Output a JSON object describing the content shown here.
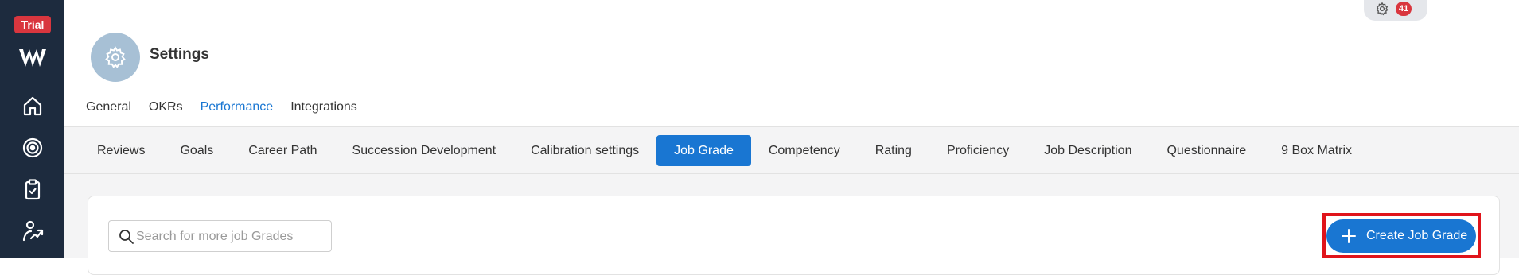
{
  "sidebar": {
    "trial_label": "Trial",
    "items": [
      {
        "icon": "home-icon"
      },
      {
        "icon": "target-icon"
      },
      {
        "icon": "clipboard-check-icon"
      },
      {
        "icon": "person-growth-icon"
      }
    ]
  },
  "topbar": {
    "notification_count": "41",
    "icon": "gear-icon"
  },
  "header": {
    "title": "Settings",
    "icon": "gear-icon"
  },
  "primary_tabs": [
    {
      "label": "General",
      "active": false
    },
    {
      "label": "OKRs",
      "active": false
    },
    {
      "label": "Performance",
      "active": true
    },
    {
      "label": "Integrations",
      "active": false
    }
  ],
  "sub_tabs": [
    {
      "label": "Reviews",
      "active": false
    },
    {
      "label": "Goals",
      "active": false
    },
    {
      "label": "Career Path",
      "active": false
    },
    {
      "label": "Succession Development",
      "active": false
    },
    {
      "label": "Calibration settings",
      "active": false
    },
    {
      "label": "Job Grade",
      "active": true
    },
    {
      "label": "Competency",
      "active": false
    },
    {
      "label": "Rating",
      "active": false
    },
    {
      "label": "Proficiency",
      "active": false
    },
    {
      "label": "Job Description",
      "active": false
    },
    {
      "label": "Questionnaire",
      "active": false
    },
    {
      "label": "9 Box Matrix",
      "active": false
    }
  ],
  "search": {
    "placeholder": "Search for more job Grades",
    "value": ""
  },
  "actions": {
    "create_label": "Create Job Grade"
  },
  "colors": {
    "accent": "#1976d2",
    "sidebar": "#1d2b3e",
    "trial": "#d9363e",
    "highlight": "#e0141b"
  }
}
